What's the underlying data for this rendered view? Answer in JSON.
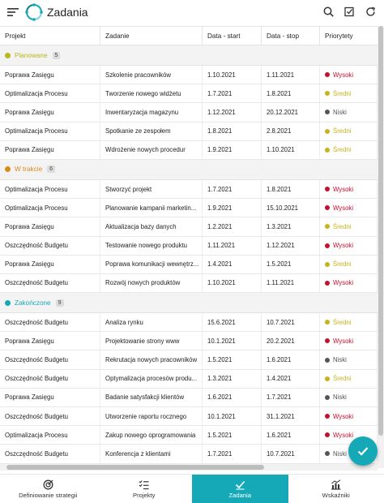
{
  "app": {
    "title": "Zadania"
  },
  "columns": [
    "Projekt",
    "Zadanie",
    "Data - start",
    "Data - stop",
    "Priorytety"
  ],
  "colors": {
    "accent": "#15a9b8",
    "planned": "#b8b81a",
    "in_progress": "#d98a1a",
    "done": "#15a9b8",
    "high": "#c8102e",
    "medium": "#c8b41a",
    "low": "#555555"
  },
  "groups": [
    {
      "label": "Planowane",
      "count": "5",
      "color": "#b8b81a",
      "rows": [
        {
          "project": "Poprawa Zasięgu",
          "task": "Szkolenie pracowników",
          "start": "1.10.2021",
          "stop": "1.11.2021",
          "priority": "Wysoki",
          "pcolor": "#c8102e"
        },
        {
          "project": "Optimalizacja Procesu",
          "task": "Tworzenie nowego widżetu",
          "start": "1.7.2021",
          "stop": "1.8.2021",
          "priority": "Średni",
          "pcolor": "#c8b41a"
        },
        {
          "project": "Poprawa Zasięgu",
          "task": "Inwentaryzacja magazynu",
          "start": "1.12.2021",
          "stop": "20.12.2021",
          "priority": "Niski",
          "pcolor": "#555555"
        },
        {
          "project": "Optimalizacja Procesu",
          "task": "Spotkanie ze zespołem",
          "start": "1.8.2021",
          "stop": "2.8.2021",
          "priority": "Średni",
          "pcolor": "#c8b41a"
        },
        {
          "project": "Poprawa Zasięgu",
          "task": "Wdrożenie nowych procedur",
          "start": "1.9.2021",
          "stop": "1.10.2021",
          "priority": "Średni",
          "pcolor": "#c8b41a"
        }
      ]
    },
    {
      "label": "W trakcie",
      "count": "6",
      "color": "#d98a1a",
      "rows": [
        {
          "project": "Optimalizacja Procesu",
          "task": "Stworzyć projekt",
          "start": "1.7.2021",
          "stop": "1.8.2021",
          "priority": "Wysoki",
          "pcolor": "#c8102e"
        },
        {
          "project": "Optimalizacja Procesu",
          "task": "Planowanie kampanii marketin...",
          "start": "1.9.2021",
          "stop": "15.10.2021",
          "priority": "Wysoki",
          "pcolor": "#c8102e"
        },
        {
          "project": "Poprawa Zasięgu",
          "task": "Aktualizacja bazy danych",
          "start": "1.2.2021",
          "stop": "1.3.2021",
          "priority": "Średni",
          "pcolor": "#c8b41a"
        },
        {
          "project": "Oszczędność Budgetu",
          "task": "Testowanie nowego produktu",
          "start": "1.11.2021",
          "stop": "1.12.2021",
          "priority": "Wysoki",
          "pcolor": "#c8102e"
        },
        {
          "project": "Poprawa Zasięgu",
          "task": "Poprawa komunikacji wewnętrz...",
          "start": "1.4.2021",
          "stop": "1.5.2021",
          "priority": "Średni",
          "pcolor": "#c8b41a"
        },
        {
          "project": "Oszczędność Budgetu",
          "task": "Rozwój nowych produktów",
          "start": "1.10.2021",
          "stop": "1.11.2021",
          "priority": "Wysoki",
          "pcolor": "#c8102e"
        }
      ]
    },
    {
      "label": "Zakończone",
      "count": "9",
      "color": "#15a9b8",
      "rows": [
        {
          "project": "Oszczędność Budgetu",
          "task": "Analiza rynku",
          "start": "15.6.2021",
          "stop": "10.7.2021",
          "priority": "Średni",
          "pcolor": "#c8b41a"
        },
        {
          "project": "Poprawa Zasięgu",
          "task": "Projektowanie strony www",
          "start": "10.1.2021",
          "stop": "20.2.2021",
          "priority": "Wysoki",
          "pcolor": "#c8102e"
        },
        {
          "project": "Oszczędność Budgetu",
          "task": "Rekrutacja nowych pracowników",
          "start": "1.5.2021",
          "stop": "1.6.2021",
          "priority": "Niski",
          "pcolor": "#555555"
        },
        {
          "project": "Oszczędność Budgetu",
          "task": "Optymalizacja procesów produ...",
          "start": "1.3.2021",
          "stop": "1.4.2021",
          "priority": "Średni",
          "pcolor": "#c8b41a"
        },
        {
          "project": "Poprawa Zasięgu",
          "task": "Badanie satysfakcji klientów",
          "start": "1.6.2021",
          "stop": "1.7.2021",
          "priority": "Niski",
          "pcolor": "#555555"
        },
        {
          "project": "Oszczędność Budgetu",
          "task": "Utworzenie raportu rocznego",
          "start": "10.1.2021",
          "stop": "31.1.2021",
          "priority": "Wysoki",
          "pcolor": "#c8102e"
        },
        {
          "project": "Optimalizacja Procesu",
          "task": "Zakup nowego oprogramowania",
          "start": "1.5.2021",
          "stop": "1.6.2021",
          "priority": "Wysoki",
          "pcolor": "#c8102e"
        },
        {
          "project": "Oszczędność Budgetu",
          "task": "Konferencja z klientami",
          "start": "1.7.2021",
          "stop": "10.7.2021",
          "priority": "Niski",
          "pcolor": "#555555"
        }
      ]
    }
  ],
  "nav": [
    {
      "label": "Definiowanie strategii",
      "icon": "target-icon",
      "active": false
    },
    {
      "label": "Projekty",
      "icon": "checklist-icon",
      "active": false
    },
    {
      "label": "Zadania",
      "icon": "task-check-icon",
      "active": true
    },
    {
      "label": "Wskaźniki",
      "icon": "chart-icon",
      "active": false
    }
  ]
}
